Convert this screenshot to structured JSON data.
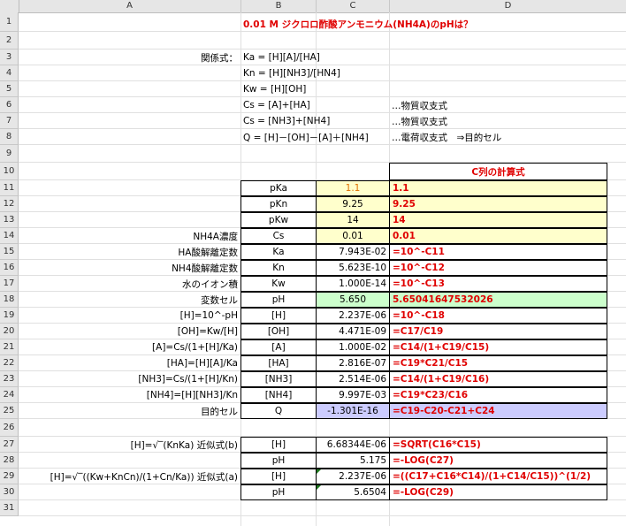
{
  "columns": [
    "A",
    "B",
    "C",
    "D"
  ],
  "rows": [
    "1",
    "2",
    "3",
    "4",
    "5",
    "6",
    "7",
    "8",
    "9",
    "10",
    "11",
    "12",
    "13",
    "14",
    "15",
    "16",
    "17",
    "18",
    "19",
    "20",
    "21",
    "22",
    "23",
    "24",
    "25",
    "26",
    "27",
    "28",
    "29",
    "30",
    "31"
  ],
  "title": "0.01 M ジクロロ酢酸アンモニウム(NH4A)のpHは？",
  "relations_label": "関係式：",
  "relations": [
    "Ka = [H][A]/[HA]",
    "Kn = [H][NH3]/[HN4]",
    "Kw = [H][OH]",
    "Cs = [A]+[HA]",
    "Cs = [NH3]+[NH4]",
    "Q = [H]－[OH]－[A]＋[NH4]"
  ],
  "notes": {
    "r6": "…物質収支式",
    "r7": "…物質収支式",
    "r8": "…電荷収支式　⇒目的セル"
  },
  "d10": "C列の計算式",
  "table": [
    {
      "a": "",
      "b": "pKa",
      "c": "1.1",
      "d": "1.1"
    },
    {
      "a": "",
      "b": "pKn",
      "c": "9.25",
      "d": "9.25"
    },
    {
      "a": "",
      "b": "pKw",
      "c": "14",
      "d": "14"
    },
    {
      "a": "NH4A濃度",
      "b": "Cs",
      "c": "0.01",
      "d": "0.01"
    },
    {
      "a": "HA酸解離定数",
      "b": "Ka",
      "c": "7.943E-02",
      "d": "=10^-C11"
    },
    {
      "a": "NH4酸解離定数",
      "b": "Kn",
      "c": "5.623E-10",
      "d": "=10^-C12"
    },
    {
      "a": "水のイオン積",
      "b": "Kw",
      "c": "1.000E-14",
      "d": "=10^-C13"
    },
    {
      "a": "変数セル",
      "b": "pH",
      "c": "5.650",
      "d": "5.65041647532026"
    },
    {
      "a": "[H]=10^-pH",
      "b": "[H]",
      "c": "2.237E-06",
      "d": "=10^-C18"
    },
    {
      "a": "[OH]=Kw/[H]",
      "b": "[OH]",
      "c": "4.471E-09",
      "d": "=C17/C19"
    },
    {
      "a": "[A]=Cs/(1+[H]/Ka)",
      "b": "[A]",
      "c": "1.000E-02",
      "d": "=C14/(1+C19/C15)"
    },
    {
      "a": "[HA]=[H][A]/Ka",
      "b": "[HA]",
      "c": "2.816E-07",
      "d": "=C19*C21/C15"
    },
    {
      "a": "[NH3]=Cs/(1+[H]/Kn)",
      "b": "[NH3]",
      "c": "2.514E-06",
      "d": "=C14/(1+C19/C16)"
    },
    {
      "a": "[NH4]=[H][NH3]/Kn",
      "b": "[NH4]",
      "c": "9.997E-03",
      "d": "=C19*C23/C16"
    },
    {
      "a": "目的セル",
      "b": "Q",
      "c": "-1.301E-16",
      "d": "=C19-C20-C21+C24"
    }
  ],
  "approx": [
    {
      "a": "[H]=√‾(KnKa)  近似式(b)",
      "b": "[H]",
      "c": "6.68344E-06",
      "d": "=SQRT(C16*C15)"
    },
    {
      "a": "",
      "b": "pH",
      "c": "5.175",
      "d": "=-LOG(C27)"
    },
    {
      "a": "[H]=√‾((Kw+KnCn)/(1+Cn/Ka))  近似式(a)",
      "b": "[H]",
      "c": "2.237E-06",
      "d": "=((C17+C16*C14)/(1+C14/C15))^(1/2)"
    },
    {
      "a": "",
      "b": "pH",
      "c": "5.6504",
      "d": "=-LOG(C29)"
    }
  ],
  "colors": {
    "red": "#e00000",
    "yellow": "#ffffcc",
    "green": "#ccffcc",
    "purple": "#ccccff"
  }
}
